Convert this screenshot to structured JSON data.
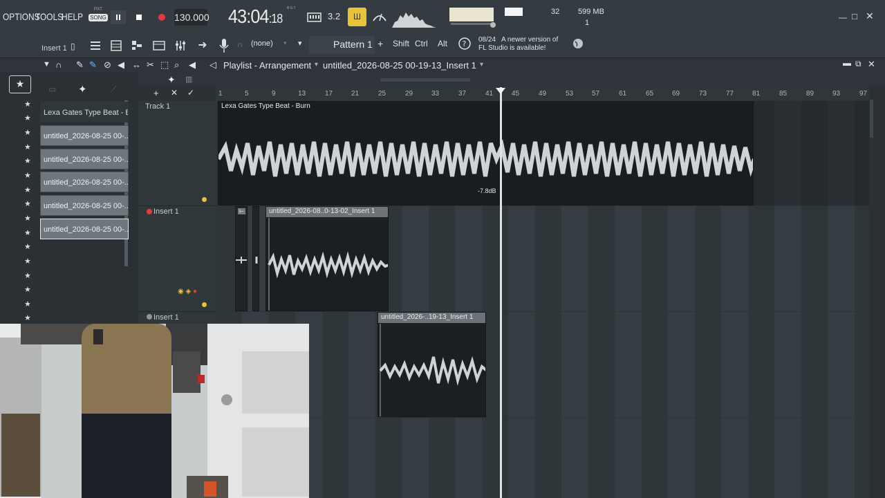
{
  "menu": {
    "options": "OPTIONS",
    "tools": "TOOLS",
    "help": "HELP"
  },
  "transport": {
    "pat_label": "PAT",
    "song_label": "SONG",
    "tempo": "130.000",
    "time_main": "43:04",
    "time_ticks": "18",
    "time_mode": "B:S:T",
    "snap": "3.2",
    "cpu_value": "32",
    "memory": "599 MB",
    "voices": "1"
  },
  "toolbar": {
    "insert_label": "Insert 1",
    "pattern_none": "(none)",
    "pattern_name": "Pattern 1",
    "plus": "+",
    "shift": "Shift",
    "ctrl": "Ctrl",
    "alt": "Alt",
    "hint_date": "08/24",
    "hint_line1": "A newer version of",
    "hint_line2": "FL Studio is available!"
  },
  "playlist": {
    "title": "Playlist - Arrangement",
    "arrangement": "untitled_2026-08-25 00-19-13_Insert 1",
    "ruler_ticks": [
      "1",
      "5",
      "9",
      "13",
      "17",
      "21",
      "25",
      "29",
      "33",
      "37",
      "41",
      "45",
      "49",
      "53",
      "57",
      "61",
      "65",
      "69",
      "73",
      "77",
      "81",
      "85",
      "89",
      "93",
      "97"
    ]
  },
  "picker": {
    "items": [
      "Lexa Gates Type Beat - Burn",
      "untitled_2026-08-25 00-...",
      "untitled_2026-08-25 00-...",
      "untitled_2026-08-25 00-...",
      "untitled_2026-08-25 00-...",
      "untitled_2026-08-25 00-..."
    ]
  },
  "tracks": {
    "track1": "Track 1",
    "insert1a": "Insert 1",
    "insert1b": "Insert 1"
  },
  "clips": {
    "beat": "Lexa Gates Type Beat - Burn",
    "db_label": "-7.8dB",
    "vocal1": "untitled_2026-08..0-13-02_Insert 1",
    "vocal2": "untitled_2026-..19-13_Insert 1"
  },
  "colors": {
    "accent_yellow": "#e8c23a",
    "record_red": "#e23b3b",
    "clip_bg": "#1c1f21",
    "wave": "#cfd3d5"
  }
}
